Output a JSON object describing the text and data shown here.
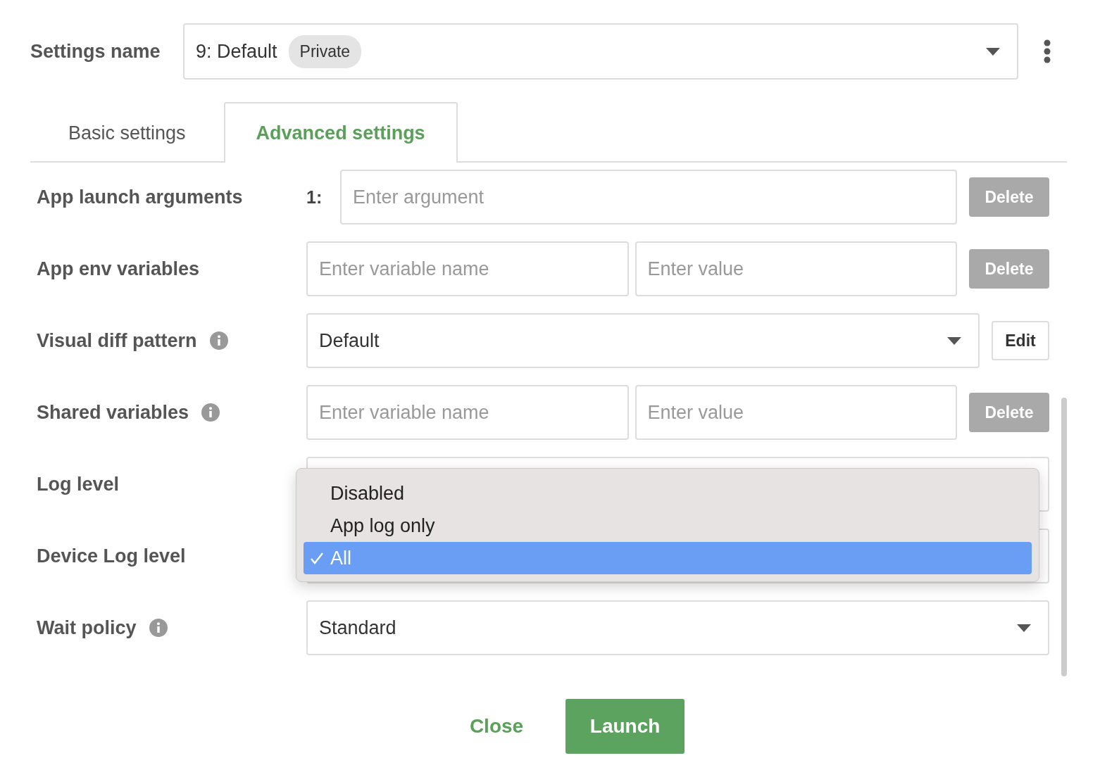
{
  "settings_name": {
    "label": "Settings name",
    "value": "9: Default",
    "badge": "Private"
  },
  "tabs": [
    {
      "label": "Basic settings",
      "selected": false
    },
    {
      "label": "Advanced settings",
      "selected": true
    }
  ],
  "rows": [
    {
      "kind": "args",
      "label": "App launch arguments",
      "info": false,
      "index": "1:",
      "placeholder": "Enter argument",
      "button": {
        "label": "Delete",
        "disabled": true
      }
    },
    {
      "kind": "pair",
      "label": "App env variables",
      "info": false,
      "name_placeholder": "Enter variable name",
      "value_placeholder": "Enter value",
      "button": {
        "label": "Delete",
        "disabled": true
      }
    },
    {
      "kind": "select",
      "label": "Visual diff pattern",
      "info": true,
      "value": "Default",
      "button": {
        "label": "Edit",
        "disabled": false
      }
    },
    {
      "kind": "pair",
      "label": "Shared variables",
      "info": true,
      "name_placeholder": "Enter variable name",
      "value_placeholder": "Enter value",
      "button": {
        "label": "Delete",
        "disabled": true
      }
    },
    {
      "kind": "select",
      "label": "Log level",
      "info": false
    },
    {
      "kind": "select",
      "label": "Device Log level",
      "info": false
    },
    {
      "kind": "select",
      "label": "Wait policy",
      "info": true,
      "value": "Standard"
    }
  ],
  "dropdown_menu": {
    "options": [
      {
        "label": "Disabled",
        "selected": false
      },
      {
        "label": "App log only",
        "selected": false
      },
      {
        "label": "All",
        "selected": true
      }
    ]
  },
  "footer": {
    "close": "Close",
    "launch": "Launch"
  }
}
